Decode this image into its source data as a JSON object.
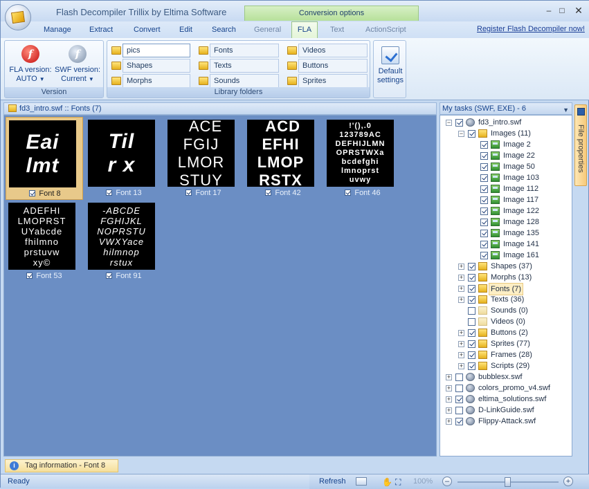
{
  "app": {
    "title": "Flash Decompiler Trillix by Eltima Software",
    "context_tab": "Conversion options",
    "window_controls": [
      "minimize",
      "maximize",
      "close"
    ]
  },
  "menu": {
    "items": [
      "Manage",
      "Extract",
      "Convert",
      "Edit",
      "Search"
    ],
    "context_tabs": [
      "General",
      "FLA",
      "Text",
      "ActionScript"
    ],
    "active_tab": "FLA",
    "register_link": "Register Flash Decompiler now!"
  },
  "ribbon": {
    "version_group": {
      "caption": "Version",
      "fla_label": "FLA version:",
      "fla_value": "AUTO",
      "swf_label": "SWF version:",
      "swf_value": "Current"
    },
    "library_group": {
      "caption": "Library folders",
      "fields": [
        "pics",
        "Shapes",
        "Morphs",
        "Fonts",
        "Texts",
        "Sounds",
        "Videos",
        "Buttons",
        "Sprites"
      ]
    },
    "default_settings": {
      "line1": "Default",
      "line2": "settings"
    }
  },
  "left_pane": {
    "header": "fd3_intro.swf :: Fonts (7)",
    "fonts": [
      {
        "name": "Font 8",
        "lines": [
          "Eai",
          "lmt"
        ],
        "selected": true
      },
      {
        "name": "Font 13",
        "lines": [
          "Til",
          "r x"
        ],
        "selected": false
      },
      {
        "name": "Font 17",
        "lines": [
          "  ACE",
          "FGIJ",
          "LMOR",
          "STUY"
        ],
        "selected": false
      },
      {
        "name": "Font 42",
        "lines": [
          " ACD",
          "EFHI",
          "LMOP",
          "RSTX"
        ],
        "selected": false
      },
      {
        "name": "Font 46",
        "lines": [
          "!'(),.0",
          "123789AC",
          "DEFHIJLMN",
          "OPRSTWXa",
          "bcdefghi",
          "lmnoprst",
          "uvwy"
        ],
        "selected": false
      },
      {
        "name": "Font 53",
        "lines": [
          "ADEFHI",
          "LMOPRST",
          "UYabcde",
          "fhilmno",
          "prstuvw",
          "xy©"
        ],
        "selected": false
      },
      {
        "name": "Font 91",
        "lines": [
          "-ABCDE",
          "FGHIJKL",
          "NOPRSTU",
          "VWXYace",
          "hilmnop",
          "rstux"
        ],
        "selected": false
      }
    ]
  },
  "right_pane": {
    "header": "My tasks (SWF, EXE) - 6",
    "side_tab": "File properties",
    "tree": [
      {
        "label": "fd3_intro.swf",
        "level": 0,
        "expander": "-",
        "checked": true,
        "icon": "swf"
      },
      {
        "label": "Images (11)",
        "level": 1,
        "expander": "-",
        "checked": true,
        "icon": "folder"
      },
      {
        "label": "Image 2",
        "level": 2,
        "checked": true,
        "icon": "image"
      },
      {
        "label": "Image 22",
        "level": 2,
        "checked": true,
        "icon": "image"
      },
      {
        "label": "Image 50",
        "level": 2,
        "checked": true,
        "icon": "image"
      },
      {
        "label": "Image 103",
        "level": 2,
        "checked": true,
        "icon": "image"
      },
      {
        "label": "Image 112",
        "level": 2,
        "checked": true,
        "icon": "image"
      },
      {
        "label": "Image 117",
        "level": 2,
        "checked": true,
        "icon": "image"
      },
      {
        "label": "Image 122",
        "level": 2,
        "checked": true,
        "icon": "image"
      },
      {
        "label": "Image 128",
        "level": 2,
        "checked": true,
        "icon": "image"
      },
      {
        "label": "Image 135",
        "level": 2,
        "checked": true,
        "icon": "image"
      },
      {
        "label": "Image 141",
        "level": 2,
        "checked": true,
        "icon": "image"
      },
      {
        "label": "Image 161",
        "level": 2,
        "checked": true,
        "icon": "image"
      },
      {
        "label": "Shapes (37)",
        "level": 1,
        "expander": "+",
        "checked": true,
        "icon": "folder"
      },
      {
        "label": "Morphs (13)",
        "level": 1,
        "expander": "+",
        "checked": true,
        "icon": "folder"
      },
      {
        "label": "Fonts (7)",
        "level": 1,
        "expander": "+",
        "checked": true,
        "icon": "folder",
        "highlight": true
      },
      {
        "label": "Texts (36)",
        "level": 1,
        "expander": "+",
        "checked": true,
        "icon": "folder"
      },
      {
        "label": "Sounds (0)",
        "level": 1,
        "checked": false,
        "icon": "folder-empty"
      },
      {
        "label": "Videos (0)",
        "level": 1,
        "checked": false,
        "icon": "folder-empty"
      },
      {
        "label": "Buttons (2)",
        "level": 1,
        "expander": "+",
        "checked": true,
        "icon": "folder"
      },
      {
        "label": "Sprites (77)",
        "level": 1,
        "expander": "+",
        "checked": true,
        "icon": "folder"
      },
      {
        "label": "Frames (28)",
        "level": 1,
        "expander": "+",
        "checked": true,
        "icon": "folder"
      },
      {
        "label": "Scripts (29)",
        "level": 1,
        "expander": "+",
        "checked": true,
        "icon": "folder"
      },
      {
        "label": "bubblesx.swf",
        "level": 0,
        "expander": "+",
        "checked": false,
        "icon": "swf"
      },
      {
        "label": "colors_promo_v4.swf",
        "level": 0,
        "expander": "+",
        "checked": false,
        "icon": "swf"
      },
      {
        "label": "eltima_solutions.swf",
        "level": 0,
        "expander": "+",
        "checked": true,
        "icon": "swf"
      },
      {
        "label": "D-LinkGuide.swf",
        "level": 0,
        "expander": "+",
        "checked": false,
        "icon": "swf"
      },
      {
        "label": "Flippy-Attack.swf",
        "level": 0,
        "expander": "+",
        "checked": true,
        "icon": "swf"
      }
    ]
  },
  "info_bar": "Tag information - Font 8",
  "status": {
    "ready": "Ready",
    "refresh": "Refresh",
    "zoom": "100%",
    "zoom_level": 0.5
  },
  "colors": {
    "workspace_bg": "#6b8ec4",
    "selection": "#e8c98a",
    "context_tab": "#b7e09b"
  }
}
